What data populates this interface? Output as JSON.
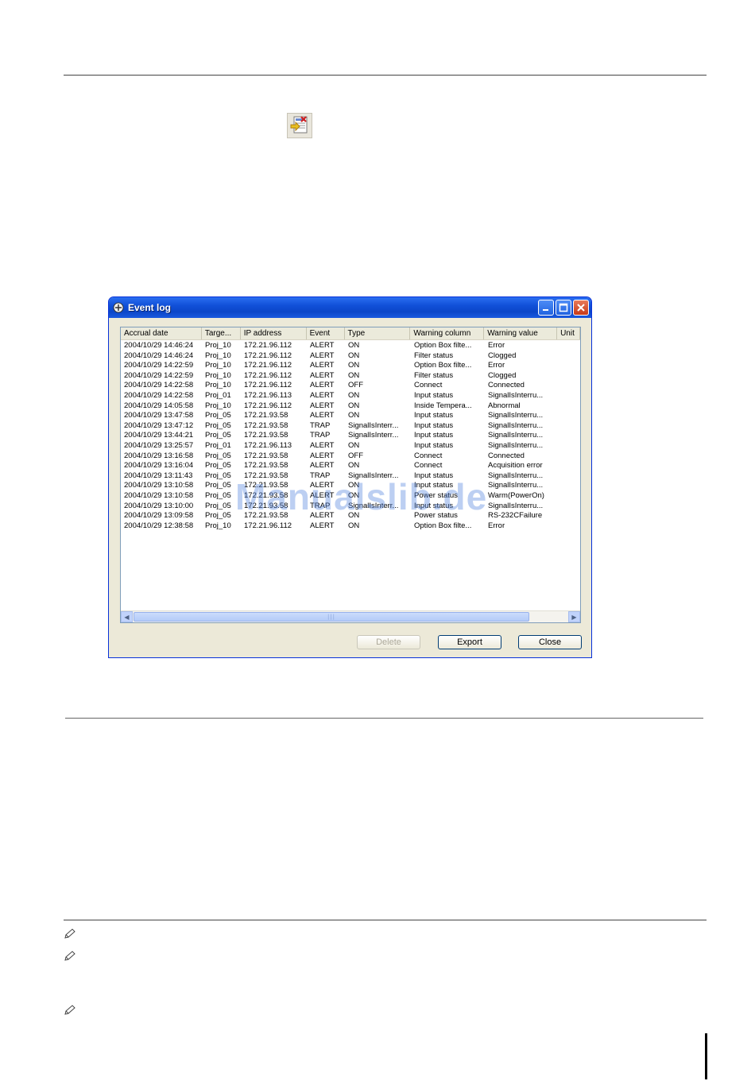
{
  "window": {
    "title": "Event log",
    "columns": [
      "Accrual date",
      "Targe...",
      "IP address",
      "Event",
      "Type",
      "Warning column",
      "Warning value",
      "Unit"
    ],
    "rows": [
      [
        "2004/10/29 14:46:24",
        "Proj_10",
        "172.21.96.112",
        "ALERT",
        "ON",
        "Option Box filte...",
        "Error"
      ],
      [
        "2004/10/29 14:46:24",
        "Proj_10",
        "172.21.96.112",
        "ALERT",
        "ON",
        "Filter status",
        "Clogged"
      ],
      [
        "2004/10/29 14:22:59",
        "Proj_10",
        "172.21.96.112",
        "ALERT",
        "ON",
        "Option Box filte...",
        "Error"
      ],
      [
        "2004/10/29 14:22:59",
        "Proj_10",
        "172.21.96.112",
        "ALERT",
        "ON",
        "Filter status",
        "Clogged"
      ],
      [
        "2004/10/29 14:22:58",
        "Proj_10",
        "172.21.96.112",
        "ALERT",
        "OFF",
        "Connect",
        "Connected"
      ],
      [
        "2004/10/29 14:22:58",
        "Proj_01",
        "172.21.96.113",
        "ALERT",
        "ON",
        "Input status",
        "SignalIsInterru..."
      ],
      [
        "2004/10/29 14:05:58",
        "Proj_10",
        "172.21.96.112",
        "ALERT",
        "ON",
        "Inside Tempera...",
        "Abnormal"
      ],
      [
        "2004/10/29 13:47:58",
        "Proj_05",
        "172.21.93.58",
        "ALERT",
        "ON",
        "Input status",
        "SignalIsInterru..."
      ],
      [
        "2004/10/29 13:47:12",
        "Proj_05",
        "172.21.93.58",
        "TRAP",
        "SignalIsInterr...",
        "Input status",
        "SignalIsInterru..."
      ],
      [
        "2004/10/29 13:44:21",
        "Proj_05",
        "172.21.93.58",
        "TRAP",
        "SignalIsInterr...",
        "Input status",
        "SignalIsInterru..."
      ],
      [
        "2004/10/29 13:25:57",
        "Proj_01",
        "172.21.96.113",
        "ALERT",
        "ON",
        "Input status",
        "SignalIsInterru..."
      ],
      [
        "2004/10/29 13:16:58",
        "Proj_05",
        "172.21.93.58",
        "ALERT",
        "OFF",
        "Connect",
        "Connected"
      ],
      [
        "2004/10/29 13:16:04",
        "Proj_05",
        "172.21.93.58",
        "ALERT",
        "ON",
        "Connect",
        "Acquisition error"
      ],
      [
        "2004/10/29 13:11:43",
        "Proj_05",
        "172.21.93.58",
        "TRAP",
        "SignalIsInterr...",
        "Input status",
        "SignalIsInterru..."
      ],
      [
        "2004/10/29 13:10:58",
        "Proj_05",
        "172.21.93.58",
        "ALERT",
        "ON",
        "Input status",
        "SignalIsInterru..."
      ],
      [
        "2004/10/29 13:10:58",
        "Proj_05",
        "172.21.93.58",
        "ALERT",
        "ON",
        "Power status",
        "Warm(PowerOn)"
      ],
      [
        "2004/10/29 13:10:00",
        "Proj_05",
        "172.21.93.58",
        "TRAP",
        "SignalIsInterr...",
        "Input status",
        "SignalIsInterru..."
      ],
      [
        "2004/10/29 13:09:58",
        "Proj_05",
        "172.21.93.58",
        "ALERT",
        "ON",
        "Power status",
        "RS-232CFailure"
      ],
      [
        "2004/10/29 12:38:58",
        "Proj_10",
        "172.21.96.112",
        "ALERT",
        "ON",
        "Option Box filte...",
        "Error"
      ]
    ],
    "buttons": {
      "delete": "Delete",
      "export": "Export",
      "close": "Close"
    },
    "scrollbar_grip": "|||"
  },
  "watermark": "Manualslib.de",
  "icons": [
    "event-log-toolbar-icon",
    "note-pencil-icon"
  ]
}
